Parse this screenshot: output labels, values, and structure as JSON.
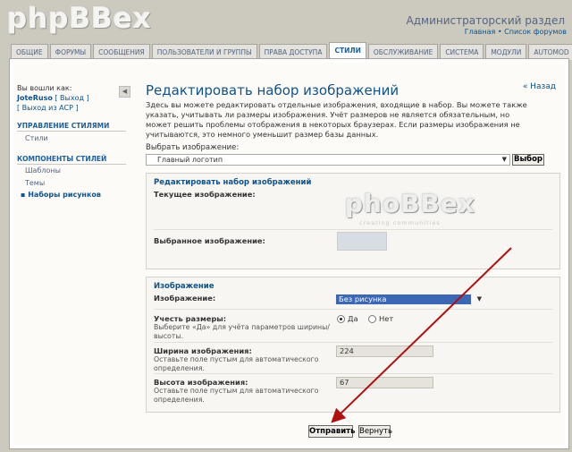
{
  "header": {
    "logo": "phpBBex",
    "admin_title": "Администраторский раздел",
    "links": [
      "Главная",
      "•",
      "Список форумов"
    ]
  },
  "tabs": [
    {
      "label": "ОБЩИЕ"
    },
    {
      "label": "ФОРУМЫ"
    },
    {
      "label": "СООБЩЕНИЯ"
    },
    {
      "label": "ПОЛЬЗОВАТЕЛИ И ГРУППЫ"
    },
    {
      "label": "ПРАВА ДОСТУПА"
    },
    {
      "label": "СТИЛИ"
    },
    {
      "label": "ОБСЛУЖИВАНИЕ"
    },
    {
      "label": "СИСТЕМА"
    },
    {
      "label": "МОДУЛИ"
    },
    {
      "label": "AUTOMOD"
    }
  ],
  "sidebar": {
    "logged_in_label": "Вы вошли как:",
    "username": "JoteRuso",
    "logout": "[ Выход ]",
    "acp_logout": "[ Выход из ACP ]",
    "section1_title": "УПРАВЛЕНИЕ СТИЛЯМИ",
    "section1_items": [
      "Стили"
    ],
    "section2_title": "КОМПОНЕНТЫ СТИЛЕЙ",
    "section2_items": [
      "Шаблоны",
      "Темы",
      "Наборы рисунков"
    ],
    "collapse_icon": "◀"
  },
  "main": {
    "back_link": "« Назад",
    "title": "Редактировать набор изображений",
    "description": "Здесь вы можете редактировать отдельные изображения, входящие в набор. Вы можете также указать, учитывать ли размеры изображения. Учёт размеров не является обязательным, но может решить проблемы отображения в некоторых браузерах. Если размеры изображения не учитываются, это немного уменьшит размер базы данных.",
    "select_label": "Выбрать изображение:",
    "select_value": "Главный логотип",
    "select_button": "Выбор",
    "fieldset1": {
      "legend": "Редактировать набор изображений",
      "current_label": "Текущее изображение:",
      "selected_label": "Выбранное изображение:",
      "preview_logo": "phoBBex",
      "preview_sub": "creating communities"
    },
    "fieldset2": {
      "legend": "Изображение",
      "image_label": "Изображение:",
      "image_value": "Без рисунка",
      "dims_label": "Учесть размеры:",
      "dims_hint": "Выберите «Да» для учёта параметров ширины/высоты.",
      "yes": "Да",
      "no": "Нет",
      "width_label": "Ширина изображения:",
      "width_hint": "Оставьте поле пустым для автоматического определения.",
      "width_value": "224",
      "height_label": "Высота изображения:",
      "height_hint": "Оставьте поле пустым для автоматического определения.",
      "height_value": "67"
    },
    "submit": "Отправить",
    "reset": "Вернуть"
  },
  "colors": {
    "accent": "#105289",
    "arrow": "#b01010",
    "selection": "#3b67b5"
  }
}
